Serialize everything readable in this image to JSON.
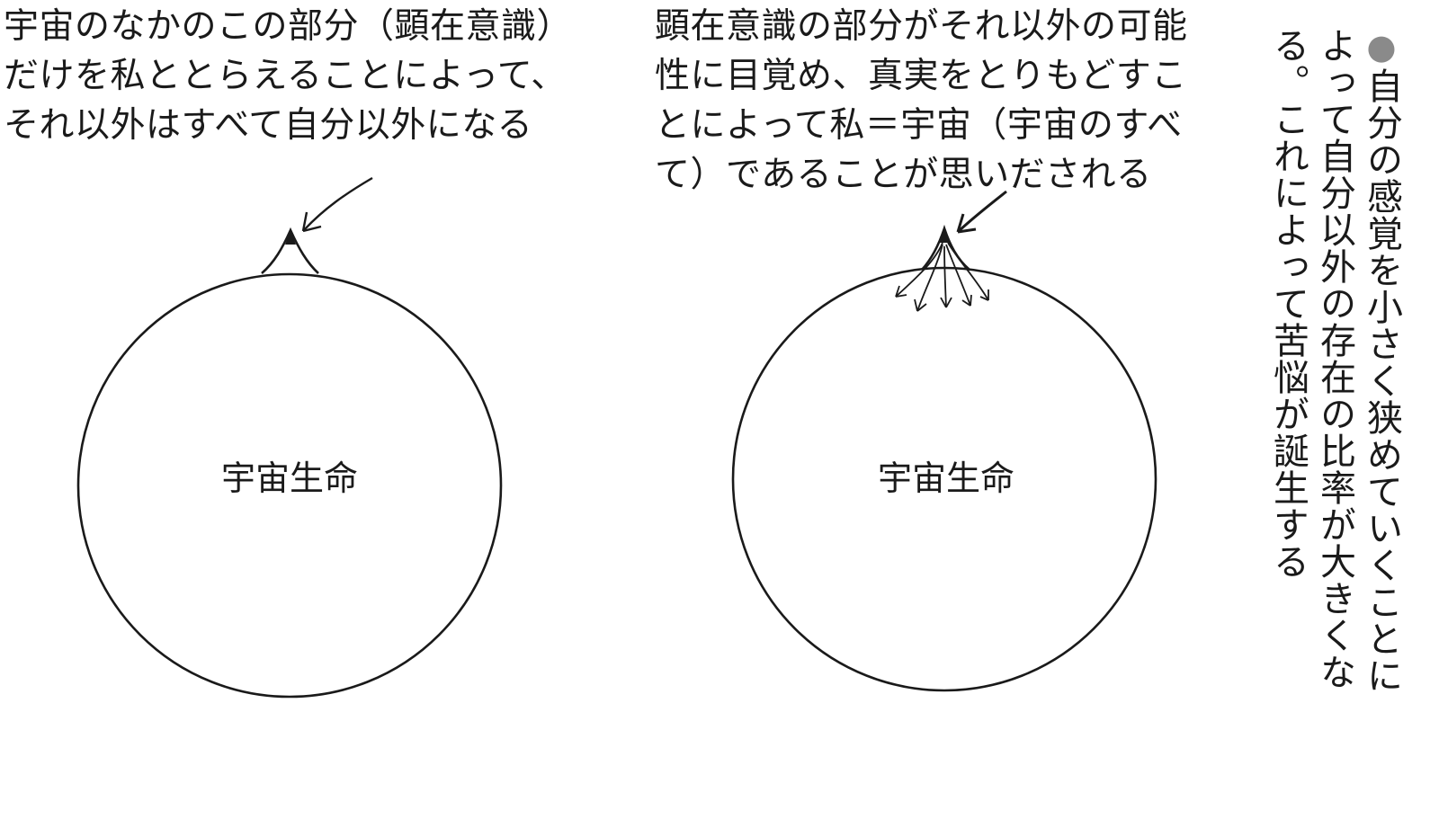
{
  "left_panel": {
    "caption_lines": [
      "宇宙のなかのこの部分（顕在意識）",
      "だけを私ととらえることによって、",
      "それ以外はすべて自分以外になる"
    ],
    "circle_label": "宇宙生命"
  },
  "right_panel": {
    "caption_lines": [
      "顕在意識の部分がそれ以外の可能",
      "性に目覚め、真実をとりもどすこ",
      "とによって私＝宇宙（宇宙のすべ",
      "て）であることが思いだされる"
    ],
    "circle_label": "宇宙生命"
  },
  "side_note": {
    "bullet": "●",
    "columns": [
      "自分の感覚を小さく狭めていくことに",
      "よって自分以外の存在の比率が大きくな",
      "る。これによって苦悩が誕生する"
    ]
  },
  "colors": {
    "ink": "#1a1a1a",
    "bullet": "#8a8a8a",
    "background": "#ffffff"
  }
}
